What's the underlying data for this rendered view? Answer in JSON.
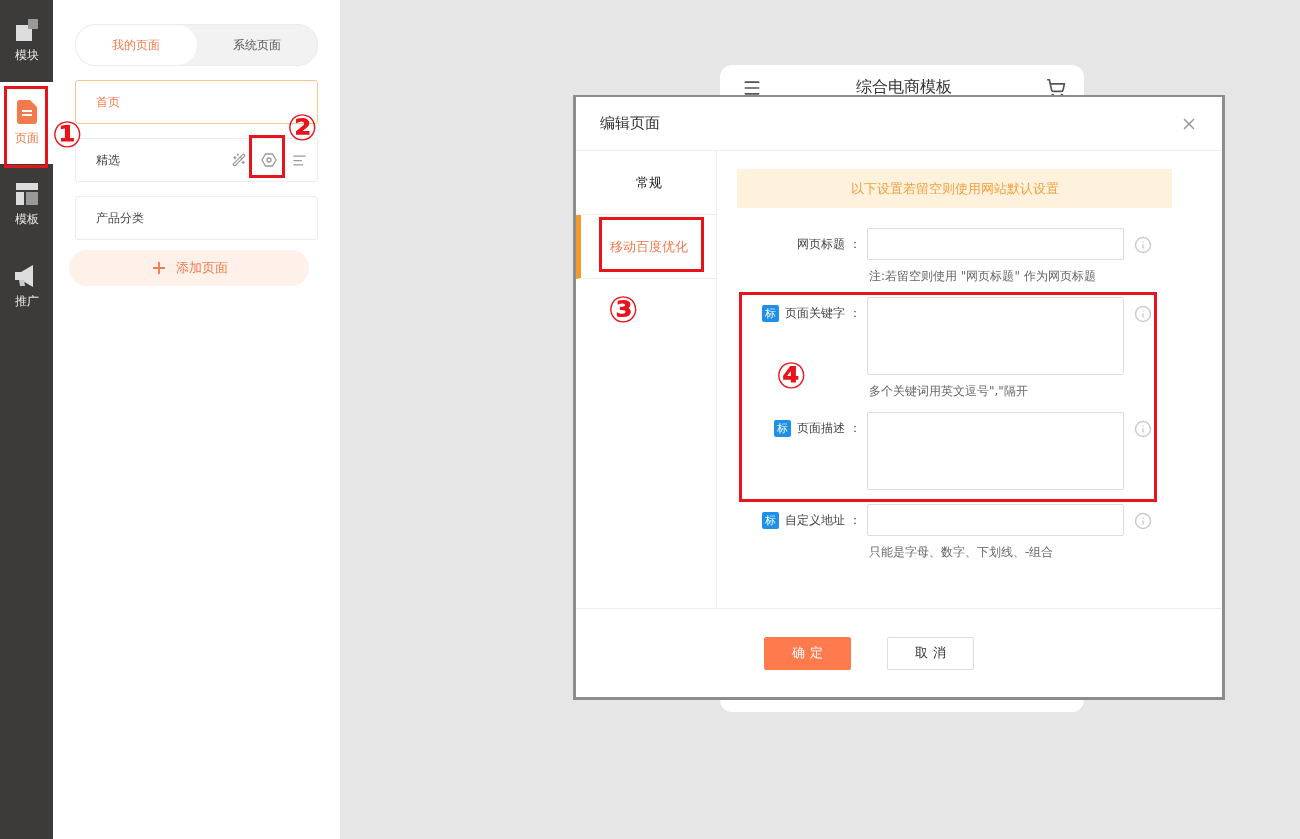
{
  "rail": [
    {
      "label": "模块",
      "selected": false
    },
    {
      "label": "页面",
      "selected": true
    },
    {
      "label": "模板",
      "selected": false
    },
    {
      "label": "推广",
      "selected": false
    }
  ],
  "page_tabs": [
    {
      "label": "我的页面",
      "selected": true
    },
    {
      "label": "系统页面",
      "selected": false
    }
  ],
  "pages": [
    {
      "label": "首页",
      "selected": true,
      "hovered": false
    },
    {
      "label": "精选",
      "selected": false,
      "hovered": true
    },
    {
      "label": "产品分类",
      "selected": false,
      "hovered": false
    }
  ],
  "add_page": "添加页面",
  "preview": {
    "title": "综合电商模板"
  },
  "dialog": {
    "title": "编辑页面",
    "tabs": [
      {
        "label": "常规",
        "selected": false
      },
      {
        "label": "移动百度优化",
        "selected": true
      }
    ],
    "notice": "以下设置若留空则使用网站默认设置",
    "fields": [
      {
        "kind": "input",
        "label": "网页标题 ：",
        "note": "注:若留空则使用 \"网页标题\" 作为网页标题"
      },
      {
        "kind": "textarea",
        "badge": "标",
        "label": "页面关键字 ：",
        "note": "多个关键词用英文逗号\",\"隔开"
      },
      {
        "kind": "textarea",
        "badge": "标",
        "label": "页面描述 ："
      },
      {
        "kind": "input",
        "badge": "标",
        "label": "自定义地址 ：",
        "note": "只能是字母、数字、下划线、-组合"
      }
    ],
    "buttons": [
      {
        "kind": "primary",
        "label": "确 定"
      },
      {
        "kind": "secondary",
        "label": "取 消"
      }
    ]
  },
  "annotations": [
    {
      "label": "①"
    },
    {
      "label": "②"
    },
    {
      "label": "③"
    },
    {
      "label": "④"
    }
  ]
}
